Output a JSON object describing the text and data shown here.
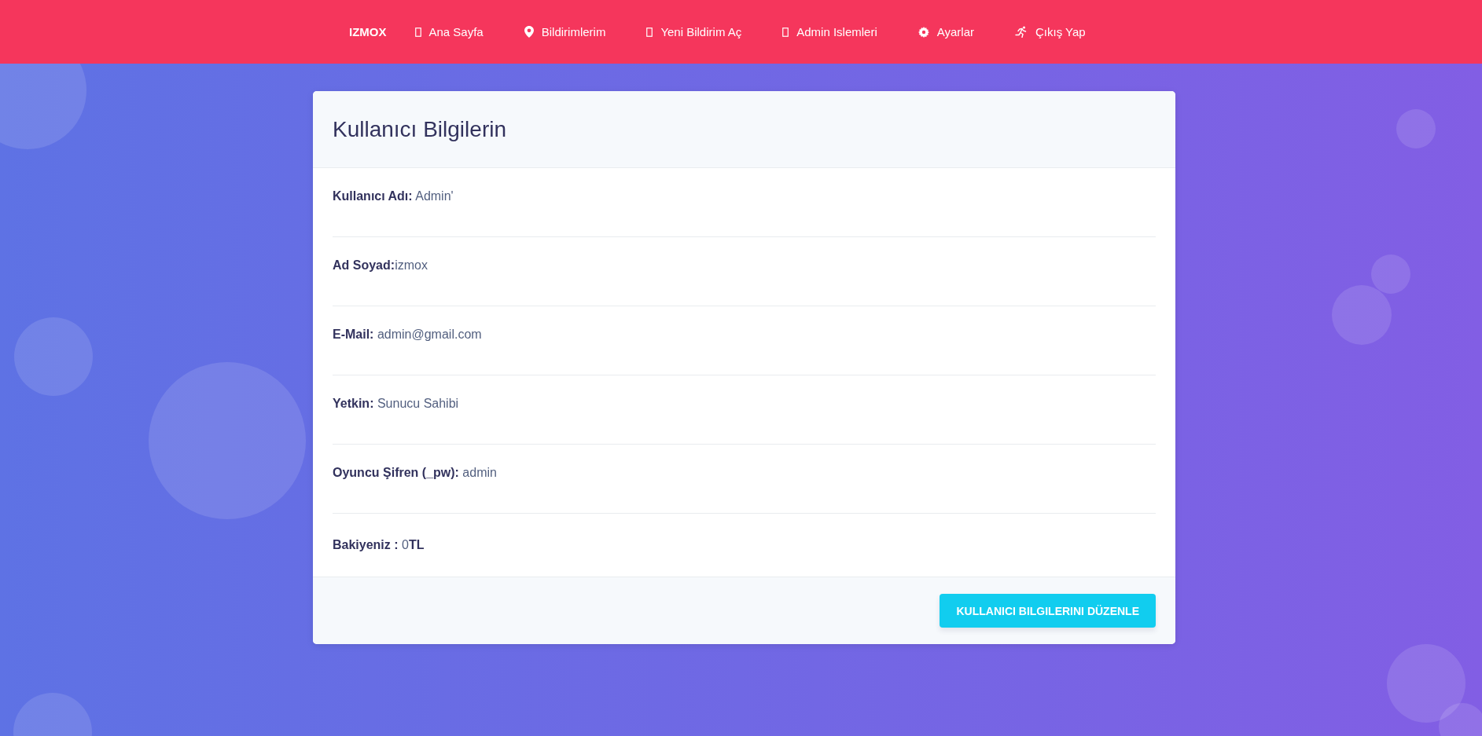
{
  "navbar": {
    "brand": "IZMOX",
    "items": [
      {
        "kind": "box",
        "label": "Ana Sayfa"
      },
      {
        "kind": "pin",
        "label": "Bildirimlerim"
      },
      {
        "kind": "box",
        "label": "Yeni Bildirim Aç"
      },
      {
        "kind": "box",
        "label": "Admin Islemleri"
      },
      {
        "kind": "gear",
        "label": "Ayarlar"
      },
      {
        "kind": "runner",
        "label": "Çıkış Yap"
      }
    ]
  },
  "card": {
    "title": "Kullanıcı Bilgilerin",
    "rows": [
      "**Kullanıcı Adı:** Admin'",
      "**Ad Soyad:**izmox",
      "**E-Mail:** admin@gmail.com",
      "**Yetkin:** Sunucu Sahibi",
      "**Oyuncu Şifren (_pw):** admin",
      "**Bakiyeniz :** 0**TL**"
    ],
    "button": "KULLANICI BILGILERINI DÜZENLE"
  }
}
